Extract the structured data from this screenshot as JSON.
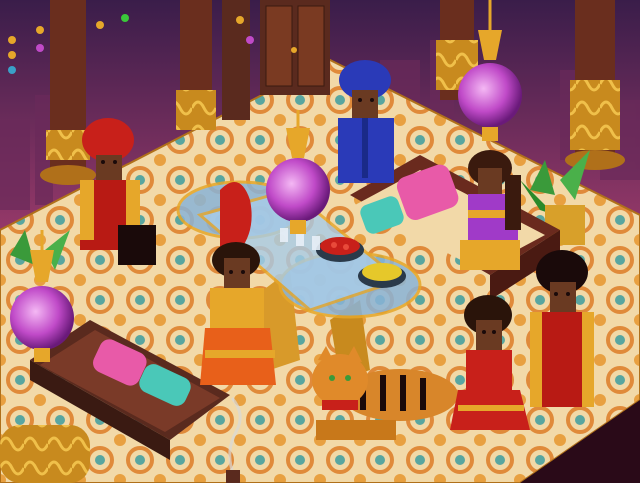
{
  "scene": {
    "name": "indian-palace-room",
    "palette": {
      "sky_top": "#3a1d4a",
      "sky_mid": "#9a3a6a",
      "sky_glow": "#e0663a",
      "floor_base": "#f2d9a8",
      "floor_pattern": "#e08a3a",
      "floor_teal": "#5aa6a0",
      "wood": "#5a2a1e",
      "wood_light": "#8a4a2a",
      "gold": "#e6a72a",
      "gold_dark": "#b0701a",
      "lamp_purple": "#c04ac8",
      "lamp_glow": "#e08ae8",
      "glass_table": "#8ab4d8",
      "skin": "#6a3a22",
      "red": "#c8201a",
      "blue_turban": "#2a3ab8",
      "tiger": "#d8862a",
      "sofa_pink": "#e85aa8",
      "sofa_teal": "#4ac8b8",
      "plant": "#3a9a3a"
    }
  },
  "characters": [
    {
      "id": "red-turban-man",
      "outfit": "red-sherwani",
      "turban": "red"
    },
    {
      "id": "blue-turban-man",
      "outfit": "blue-kurta",
      "turban": "blue"
    },
    {
      "id": "woman-cobra-hat",
      "outfit": "orange-gold-lehenga"
    },
    {
      "id": "woman-purple-sari",
      "outfit": "purple-sari"
    },
    {
      "id": "woman-red-lehenga",
      "outfit": "red-lehenga"
    },
    {
      "id": "man-red-jacket",
      "outfit": "red-gold-sherwani"
    }
  ],
  "furniture": [
    {
      "id": "glass-dining-table"
    },
    {
      "id": "carved-wooden-sofa-left"
    },
    {
      "id": "carved-wooden-sofa-right"
    },
    {
      "id": "gold-pillar-left"
    },
    {
      "id": "gold-pillar-right"
    },
    {
      "id": "palace-door"
    }
  ],
  "lamps": [
    {
      "id": "lamp-top-right"
    },
    {
      "id": "lamp-center"
    },
    {
      "id": "lamp-left"
    }
  ],
  "items": [
    {
      "id": "tiger-pet"
    },
    {
      "id": "bowl-curry"
    },
    {
      "id": "bowl-corn"
    },
    {
      "id": "incense-smoke"
    },
    {
      "id": "potted-plant"
    }
  ]
}
